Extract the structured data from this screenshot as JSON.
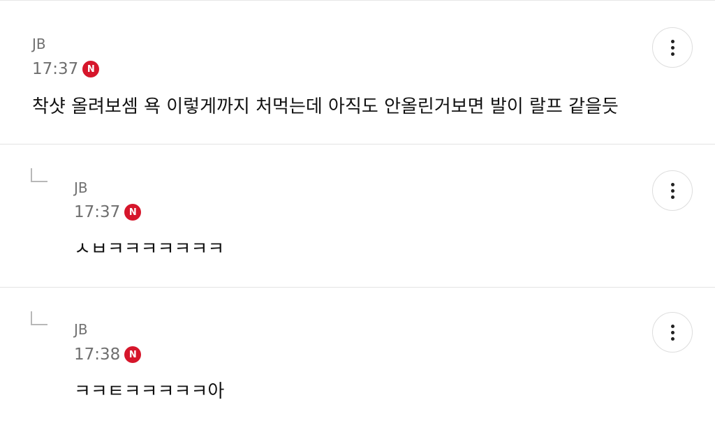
{
  "comments": [
    {
      "author": "JB",
      "time": "17:37",
      "badge": "N",
      "text": "착샷 올려보셈 욕 이렇게까지 처먹는데 아직도 안올린거보면 발이 랄프 같을듯",
      "is_reply": false,
      "more_icon": "more-vertical-icon"
    },
    {
      "author": "JB",
      "time": "17:37",
      "badge": "N",
      "text": "ㅅㅂㅋㅋㅋㅋㅋㅋㅋ",
      "is_reply": true,
      "reply_icon": "reply-arrow-icon",
      "more_icon": "more-vertical-icon"
    },
    {
      "author": "JB",
      "time": "17:38",
      "badge": "N",
      "text": "ㅋㅋㅌㅋㅋㅋㅋㅋ아",
      "is_reply": true,
      "reply_icon": "reply-arrow-icon",
      "more_icon": "more-vertical-icon"
    }
  ],
  "colors": {
    "new_badge": "#d6162b",
    "meta_text": "#6f6f6f",
    "body_text": "#111111",
    "divider": "#e3e3e3"
  }
}
